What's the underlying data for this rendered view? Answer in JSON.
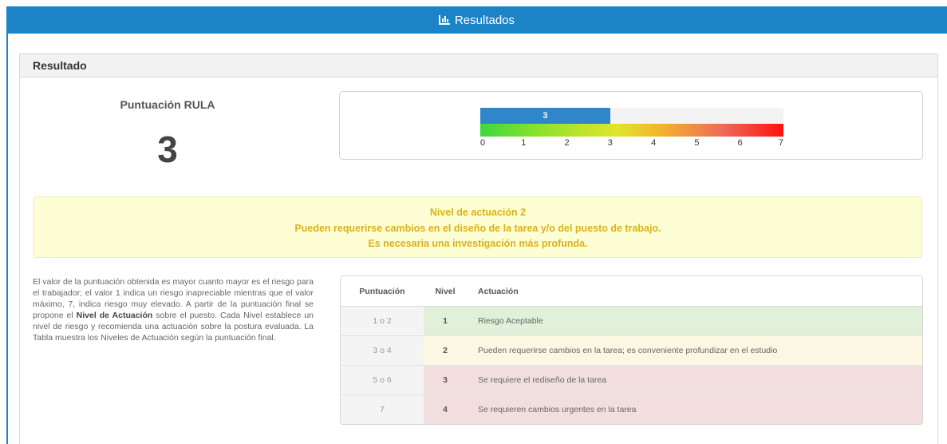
{
  "header": {
    "title": "Resultados",
    "icon": "bar-chart-icon"
  },
  "panel": {
    "title": "Resultado"
  },
  "score": {
    "label": "Puntuación RULA",
    "value": "3"
  },
  "gauge": {
    "value": 3,
    "max": 7,
    "fill_label": "3",
    "ticks": [
      "0",
      "1",
      "2",
      "3",
      "4",
      "5",
      "6",
      "7"
    ]
  },
  "alert": {
    "line1": "Nivel de actuación 2",
    "line2": "Pueden requerirse cambios en el diseño de la tarea y/o del puesto de trabajo.",
    "line3": "Es necesaria una investigación más profunda."
  },
  "description": {
    "part1": "El valor de la puntuación obtenida es mayor cuanto mayor es el riesgo para el trabajador; el valor 1 indica un riesgo inapreciable mientras que el valor máximo, 7, indica riesgo muy elevado. A partir de la puntuación final se propone el ",
    "bold": "Nivel de Actuación",
    "part2": " sobre el puesto. Cada Nivel establece un nivel de riesgo y recomienda una actuación sobre la postura evaluada. La Tabla muestra los Niveles de Actuación según la puntuación final."
  },
  "table": {
    "headers": [
      "Puntuación",
      "Nivel",
      "Actuación"
    ],
    "rows": [
      {
        "puntuacion": "1 o 2",
        "nivel": "1",
        "actuacion": "Riesgo Aceptable",
        "color": "#e1f0d9"
      },
      {
        "puntuacion": "3 o 4",
        "nivel": "2",
        "actuacion": "Pueden requerirse cambios en la tarea; es conveniente profundizar en el estudio",
        "color": "#fbf7e3"
      },
      {
        "puntuacion": "5 o 6",
        "nivel": "3",
        "actuacion": "Se requiere el rediseño de la tarea",
        "color": "#f2dedf"
      },
      {
        "puntuacion": "7",
        "nivel": "4",
        "actuacion": "Se requieren cambios urgentes en la tarea",
        "color": "#f2dedf"
      }
    ]
  },
  "colors": {
    "header_bg": "#1b84c7",
    "gauge_fill": "#2f86c8",
    "alert_text": "#d9b21a",
    "alert_bg": "#fefed4"
  }
}
